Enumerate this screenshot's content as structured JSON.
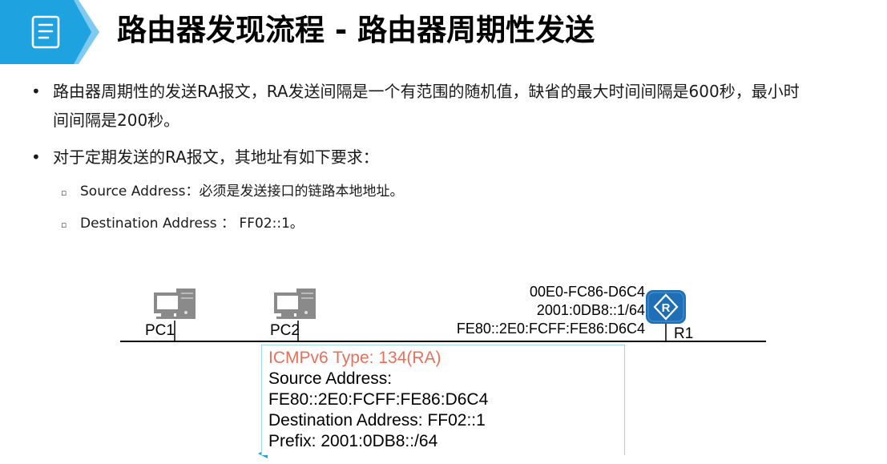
{
  "header": {
    "title": "路由器发现流程 - 路由器周期性发送",
    "icon": "document-icon",
    "badge_color": "#1fa2e0",
    "badge_shadow_color": "#7fcaf0"
  },
  "bullets": [
    {
      "line1": "路由器周期性的发送RA报文，RA发送间隔是一个有范围的随机值，缺省的最大时间间隔是600秒，最小时",
      "line2": "间间隔是200秒。"
    },
    {
      "line1": "对于定期发送的RA报文，其地址有如下要求："
    }
  ],
  "sub_items": [
    "Source Address：必须是发送接口的链路本地地址。",
    "Destination Address ： FF02::1。"
  ],
  "topology": {
    "pc1_label": "PC1",
    "pc2_label": "PC2",
    "r1_label": "R1",
    "router_icon": "router-icon",
    "pc_icon": "desktop-computer-icon",
    "router_color": "#1e6fb6",
    "r1_info": [
      "00E0-FC86-D6C4",
      "2001:0DB8::1/64",
      "FE80::2E0:FCFF:FE86:D6C4"
    ]
  },
  "ra_message": {
    "type_line": "ICMPv6 Type: 134(RA)",
    "type_color": "#e8705a",
    "lines": [
      "Source Address:",
      "FE80::2E0:FCFF:FE86:D6C4",
      "Destination Address: FF02::1",
      "Prefix: 2001:0DB8::/64"
    ],
    "arrow_color": "#1fa2e0"
  }
}
